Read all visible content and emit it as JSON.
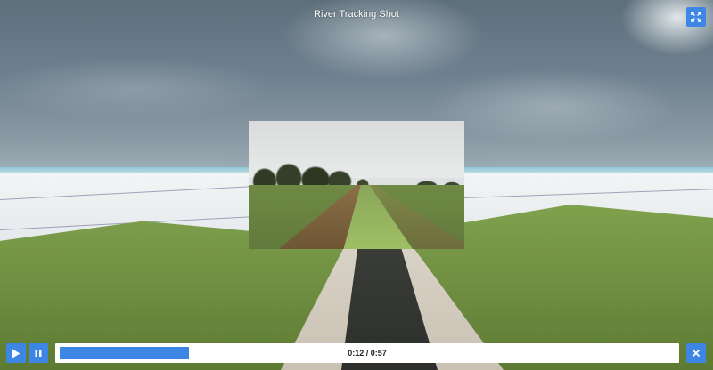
{
  "player": {
    "title": "River Tracking Shot",
    "time_display": "0:12 / 0:57",
    "progress": 0.21
  },
  "controls": {
    "fullscreen_icon": "expand-icon",
    "play_icon": "play-icon",
    "pause_icon": "pause-icon",
    "close_icon": "close-icon"
  },
  "colors": {
    "accent": "#3d86e4",
    "title_text": "#ffffff"
  }
}
